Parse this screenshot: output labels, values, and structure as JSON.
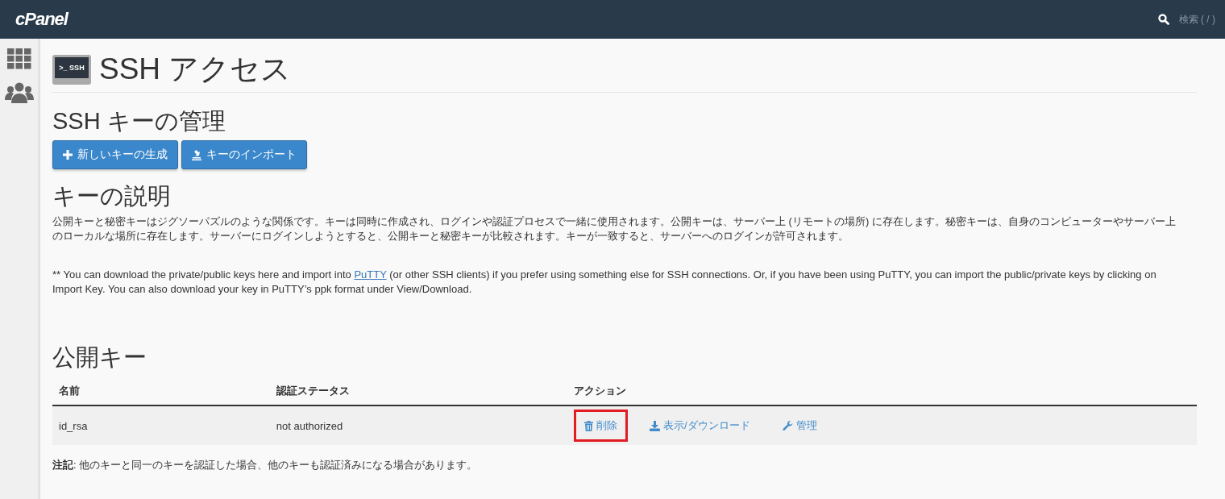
{
  "header": {
    "logo": "cPanel",
    "search_placeholder": "検索 ( / )"
  },
  "page": {
    "title": "SSH アクセス",
    "icon_text": ">_ SSH"
  },
  "manage": {
    "heading": "SSH キーの管理",
    "buttons": [
      {
        "kind": "plus",
        "label": "新しいキーの生成"
      },
      {
        "kind": "import",
        "label": "キーのインポート"
      }
    ]
  },
  "description": {
    "heading": "キーの説明",
    "paragraph": "公開キーと秘密キーはジグソーパズルのような関係です。キーは同時に作成され、ログインや認証プロセスで一緒に使用されます。公開キーは、サーバー上 (リモートの場所) に存在します。秘密キーは、自身のコンピューターやサーバー上のローカルな場所に存在します。サーバーにログインしようとすると、公開キーと秘密キーが比較されます。キーが一致すると、サーバーへのログインが許可されます。",
    "note_before": "** You can download the private/public keys here and import into",
    "note_link": "PuTTY",
    "note_after": "(or other SSH clients) if you prefer using something else for SSH connections. Or, if you have been using PuTTY, you can import the public/private keys by clicking on Import Key. You can also download your key in PuTTY’s ppk format under View/Download."
  },
  "public_keys": {
    "heading": "公開キー",
    "table": {
      "columns": [
        "名前",
        "認証ステータス",
        "アクション"
      ],
      "rows": [
        {
          "name": "id_rsa",
          "status": "not authorized",
          "actions": [
            {
              "kind": "delete",
              "label": "削除",
              "highlighted": true
            },
            {
              "kind": "download",
              "label": "表示/ダウンロード",
              "highlighted": false
            },
            {
              "kind": "manage",
              "label": "管理",
              "highlighted": false
            }
          ]
        }
      ]
    },
    "footnote": "**注記**: 他のキーと同一のキーを認証した場合、他のキーも認証済みになる場合があります。"
  }
}
